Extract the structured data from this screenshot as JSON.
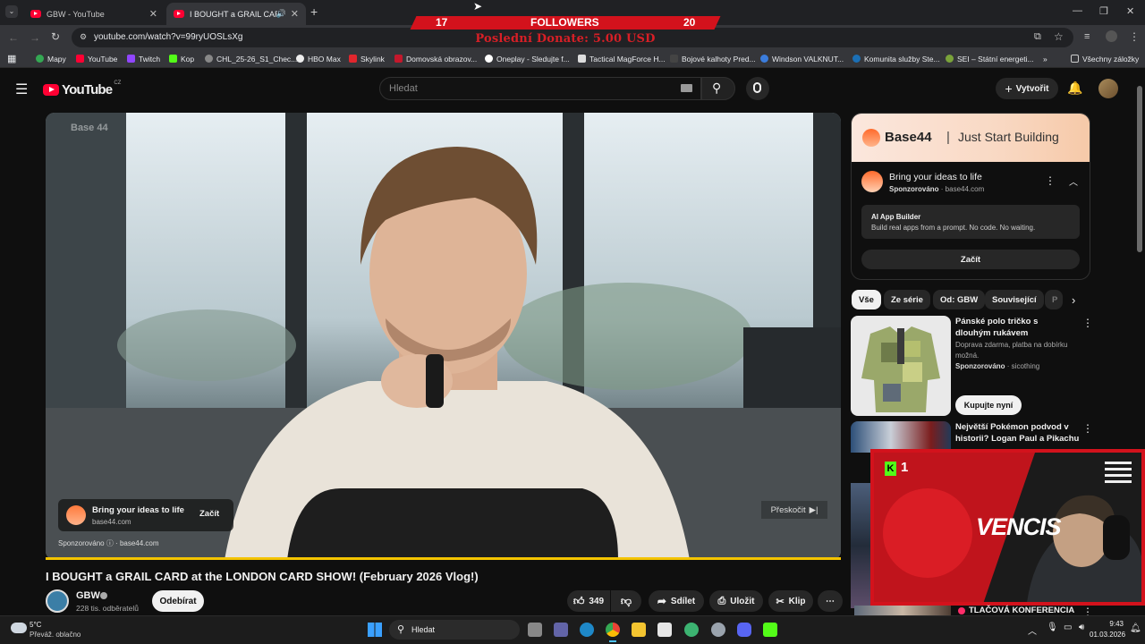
{
  "browser": {
    "tabs": [
      {
        "title": "GBW - YouTube"
      },
      {
        "title": "I BOUGHT a GRAIL CARD at"
      }
    ],
    "url": "youtube.com/watch?v=99ryUOSLsXg",
    "bookmarks": [
      "Mapy",
      "YouTube",
      "Twitch",
      "Kop",
      "CHL_25-26_S1_Chec...",
      "HBO Max",
      "Skylink",
      "Domovská obrazov...",
      "Oneplay - Sledujte f...",
      "Tactical MagForce H...",
      "Bojové kalhoty Pred...",
      "Windson VALKNUT...",
      "Komunita služby Ste...",
      "SEI – Státní energeti..."
    ],
    "bookmarks_all": "Všechny záložky"
  },
  "overlay": {
    "followers_left": "17",
    "followers_label": "FOLLOWERS",
    "followers_right": "20",
    "donate": "Poslední Donate: 5.00 USD",
    "cam_badge": "1",
    "cam_text": "VENCIS"
  },
  "youtube": {
    "logo": "YouTube",
    "region": "CZ",
    "search_placeholder": "Hledat",
    "create_label": "Vytvořit"
  },
  "video": {
    "watermark": "Base 44",
    "ad_title": "Bring your ideas to life",
    "ad_domain": "base44.com",
    "ad_cta": "Začít",
    "skip_label": "Přeskočit",
    "sponsored": "Sponzorováno",
    "sponsored_domain": "base44.com",
    "title": "I BOUGHT a GRAIL CARD at the LONDON CARD SHOW! (February 2026 Vlog!)"
  },
  "channel": {
    "name": "GBW",
    "subscribers": "228 tis. odběratelů",
    "subscribe_label": "Odebírat",
    "likes": "349",
    "share": "Sdílet",
    "save": "Uložit",
    "clip": "Klip"
  },
  "sidebar": {
    "ad_brand": "Base44",
    "ad_tagline": "Just Start Building",
    "ad_title": "Bring your ideas to life",
    "ad_sponsor": "Sponzorováno",
    "ad_domain": "base44.com",
    "ad_box_title": "AI App Builder",
    "ad_box_text": "Build real apps from a prompt. No code. No waiting.",
    "ad_cta": "Začít",
    "chips": [
      "Vše",
      "Ze série",
      "Od: GBW",
      "Související",
      "P"
    ],
    "items": [
      {
        "title": "Pánské polo tričko s dlouhým rukávem",
        "desc": "Doprava zdarma, platba na dobírku možná.",
        "sponsor": "Sponzorováno",
        "seller": "sicothing",
        "cta": "Kupujte nyní"
      },
      {
        "title": "Největší Pokémon podvod v historii? Logan Paul a Pikachu ...",
        "meta": ""
      },
      {
        "title": "TLAČOVÁ KONFERENCIA"
      }
    ]
  },
  "taskbar": {
    "weather_temp": "5°C",
    "weather_desc": "Převáž. oblačno",
    "search": "Hledat",
    "time": "9:43",
    "date": "01.03.2026"
  },
  "colors": {
    "youtube_red": "#ff0033",
    "overlay_red": "#d3121c",
    "progress": "#f4c400"
  }
}
